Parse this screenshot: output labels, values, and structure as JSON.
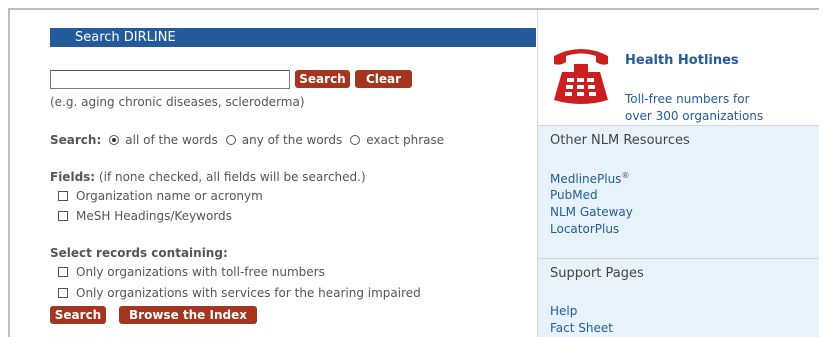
{
  "search_panel": {
    "title": "Search DIRLINE",
    "search_input_value": "",
    "search_button": "Search",
    "clear_button": "Clear",
    "hint": "(e.g. aging chronic diseases, scleroderma)",
    "search_mode_label": "Search:",
    "search_modes": [
      "all of the words",
      "any of the words",
      "exact phrase"
    ],
    "selected_mode": "all of the words",
    "fields_label": "Fields:",
    "fields_note": "(if none checked, all fields will be searched.)",
    "fields": [
      "Organization name or acronym",
      "MeSH Headings/Keywords"
    ],
    "records_label": "Select records containing:",
    "records": [
      "Only organizations with toll-free numbers",
      "Only organizations with services for the hearing impaired"
    ],
    "bottom_search_button": "Search",
    "browse_button": "Browse the Index"
  },
  "sidebar": {
    "hotlines_title": "Health Hotlines",
    "hotlines_desc_line1": "Toll-free numbers for",
    "hotlines_desc_line2": "over 300 organizations",
    "resources_title": "Other NLM Resources",
    "resources": [
      {
        "label": "MedlinePlus",
        "sup": "®"
      },
      {
        "label": "PubMed"
      },
      {
        "label": "NLM Gateway"
      },
      {
        "label": "LocatorPlus"
      }
    ],
    "support_title": "Support Pages",
    "support_links": [
      "Help",
      "Fact Sheet"
    ]
  },
  "colors": {
    "header_blue": "#235b9c",
    "button_red": "#a5351e",
    "side_bg": "#e8f2fb"
  },
  "icons": {
    "hotline_icon": "red-telephone-icon"
  }
}
